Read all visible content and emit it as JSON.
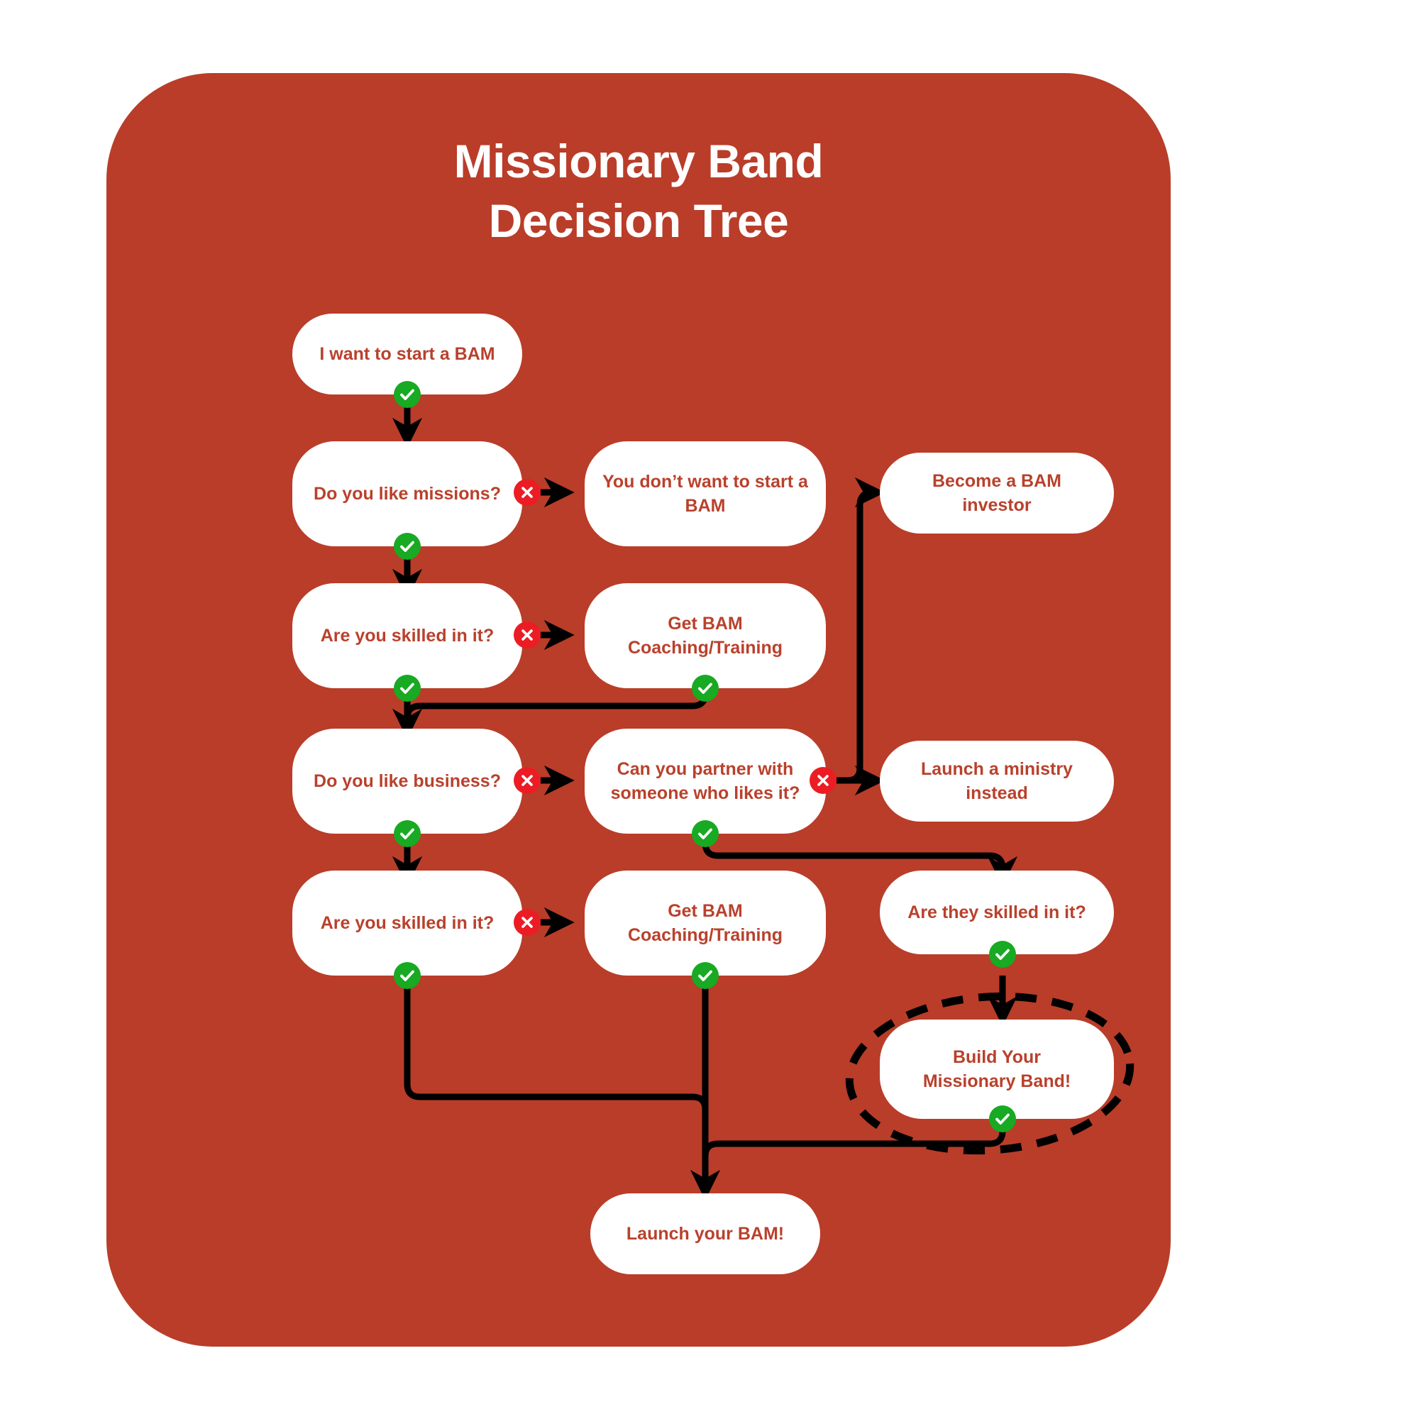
{
  "panel": {
    "background_color": "#b93d29",
    "corner_radius_px": 150
  },
  "title": {
    "line1": "Missionary Band",
    "line2": "Decision Tree",
    "color": "#ffffff"
  },
  "colors": {
    "panel_red": "#b93d29",
    "node_background": "#ffffff",
    "node_text": "#b9412c",
    "yes_badge_green": "#17aa22",
    "no_badge_red": "#ec1c24",
    "connector_black": "#000000"
  },
  "nodes": [
    {
      "id": "start",
      "label": "I want to start a BAM"
    },
    {
      "id": "like-missions",
      "label": "Do you like missions?"
    },
    {
      "id": "dont-want-bam",
      "label": "You don’t want to start a BAM"
    },
    {
      "id": "bam-investor",
      "label": "Become a BAM investor"
    },
    {
      "id": "skilled-missions",
      "label": "Are you skilled in it?"
    },
    {
      "id": "coaching-1",
      "label": "Get BAM Coaching/Training"
    },
    {
      "id": "like-business",
      "label": "Do you like business?"
    },
    {
      "id": "partner",
      "label": "Can you partner with someone who likes it?"
    },
    {
      "id": "launch-ministry",
      "label": "Launch a ministry instead"
    },
    {
      "id": "skilled-business",
      "label": "Are you skilled in it?"
    },
    {
      "id": "coaching-2",
      "label": "Get BAM Coaching/Training"
    },
    {
      "id": "they-skilled",
      "label": "Are they skilled in it?"
    },
    {
      "id": "build-band",
      "label": "Build Your Missionary Band!"
    },
    {
      "id": "launch-bam",
      "label": "Launch your BAM!"
    }
  ],
  "node_text": {
    "start": "I want to start a BAM",
    "like_missions": "Do you like missions?",
    "dont_want_bam_l1": "You don’t want to start a",
    "dont_want_bam_l2": "BAM",
    "bam_investor": "Become a BAM investor",
    "skilled_missions": "Are you skilled in it?",
    "coaching_1_l1": "Get BAM",
    "coaching_1_l2": "Coaching/Training",
    "like_business": "Do you like business?",
    "partner_l1": "Can you partner with",
    "partner_l2": "someone who likes it?",
    "launch_ministry": "Launch a ministry instead",
    "skilled_business": "Are you skilled in it?",
    "coaching_2_l1": "Get BAM",
    "coaching_2_l2": "Coaching/Training",
    "they_skilled": "Are they skilled in it?",
    "build_band_l1": "Build Your",
    "build_band_l2": "Missionary Band!",
    "launch_bam": "Launch your BAM!"
  },
  "badges": [
    {
      "id": "start-yes",
      "type": "yes",
      "on_node": "start"
    },
    {
      "id": "like-missions-yes",
      "type": "yes",
      "on_node": "like-missions"
    },
    {
      "id": "like-missions-no",
      "type": "no",
      "on_node": "like-missions"
    },
    {
      "id": "skilled-missions-yes",
      "type": "yes",
      "on_node": "skilled-missions"
    },
    {
      "id": "skilled-missions-no",
      "type": "no",
      "on_node": "skilled-missions"
    },
    {
      "id": "coaching-1-yes",
      "type": "yes",
      "on_node": "coaching-1"
    },
    {
      "id": "like-business-yes",
      "type": "yes",
      "on_node": "like-business"
    },
    {
      "id": "like-business-no",
      "type": "no",
      "on_node": "like-business"
    },
    {
      "id": "partner-yes",
      "type": "yes",
      "on_node": "partner"
    },
    {
      "id": "partner-no",
      "type": "no",
      "on_node": "partner"
    },
    {
      "id": "skilled-business-yes",
      "type": "yes",
      "on_node": "skilled-business"
    },
    {
      "id": "skilled-business-no",
      "type": "no",
      "on_node": "skilled-business"
    },
    {
      "id": "coaching-2-yes",
      "type": "yes",
      "on_node": "coaching-2"
    },
    {
      "id": "they-skilled-yes",
      "type": "yes",
      "on_node": "they-skilled"
    },
    {
      "id": "build-band-yes",
      "type": "yes",
      "on_node": "build-band"
    }
  ],
  "edges": [
    {
      "from": "start",
      "to": "like-missions",
      "branch": "yes"
    },
    {
      "from": "like-missions",
      "to": "dont-want-bam",
      "branch": "no"
    },
    {
      "from": "like-missions",
      "to": "skilled-missions",
      "branch": "yes"
    },
    {
      "from": "skilled-missions",
      "to": "coaching-1",
      "branch": "no"
    },
    {
      "from": "skilled-missions",
      "to": "like-business",
      "branch": "yes"
    },
    {
      "from": "coaching-1",
      "to": "like-business",
      "branch": "yes"
    },
    {
      "from": "like-business",
      "to": "partner",
      "branch": "no"
    },
    {
      "from": "like-business",
      "to": "skilled-business",
      "branch": "yes"
    },
    {
      "from": "partner",
      "to": "bam-investor",
      "branch": "no"
    },
    {
      "from": "partner",
      "to": "launch-ministry",
      "branch": "no"
    },
    {
      "from": "partner",
      "to": "they-skilled",
      "branch": "yes"
    },
    {
      "from": "skilled-business",
      "to": "coaching-2",
      "branch": "no"
    },
    {
      "from": "skilled-business",
      "to": "launch-bam",
      "branch": "yes"
    },
    {
      "from": "coaching-2",
      "to": "launch-bam",
      "branch": "yes"
    },
    {
      "from": "they-skilled",
      "to": "build-band",
      "branch": "yes"
    },
    {
      "from": "build-band",
      "to": "launch-bam",
      "branch": "yes"
    }
  ],
  "highlight": {
    "target_node": "build-band",
    "style": "dashed-ellipse"
  }
}
